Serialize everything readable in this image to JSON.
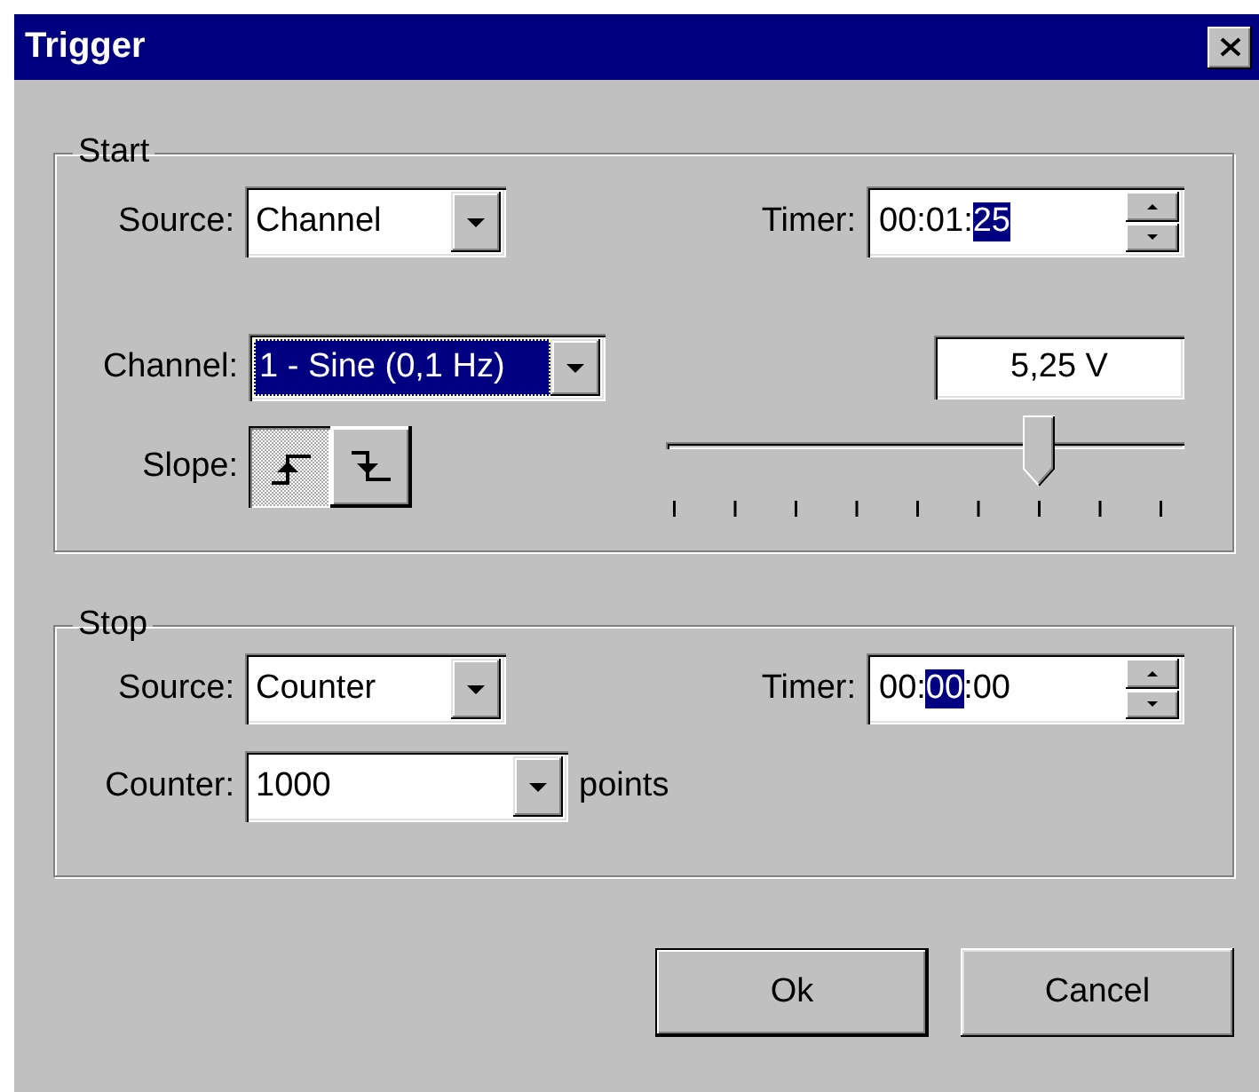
{
  "window": {
    "title": "Trigger"
  },
  "start": {
    "title": "Start",
    "source": {
      "label": "Source:",
      "value": "Channel"
    },
    "timer": {
      "label": "Timer:",
      "separator": ":",
      "segments": [
        {
          "text": "00",
          "selected": false
        },
        {
          "text": "01",
          "selected": false
        },
        {
          "text": "25",
          "selected": true
        }
      ]
    },
    "channel": {
      "label": "Channel:",
      "value": "1 - Sine (0,1 Hz)",
      "focused": true
    },
    "threshold": {
      "value": "5,25 V"
    },
    "slope": {
      "label": "Slope:",
      "options": [
        {
          "kind": "rising",
          "selected": true
        },
        {
          "kind": "falling",
          "selected": false
        }
      ]
    },
    "slider": {
      "level": 0.75
    }
  },
  "stop": {
    "title": "Stop",
    "source": {
      "label": "Source:",
      "value": "Counter"
    },
    "timer": {
      "label": "Timer:",
      "separator": ":",
      "segments": [
        {
          "text": "00",
          "selected": false
        },
        {
          "text": "00",
          "selected": true
        },
        {
          "text": "00",
          "selected": false
        }
      ]
    },
    "counter": {
      "label": "Counter:",
      "value": "1000",
      "unit": "points"
    }
  },
  "buttons": [
    {
      "label": "Ok",
      "default": true
    },
    {
      "label": "Cancel",
      "default": false
    }
  ]
}
